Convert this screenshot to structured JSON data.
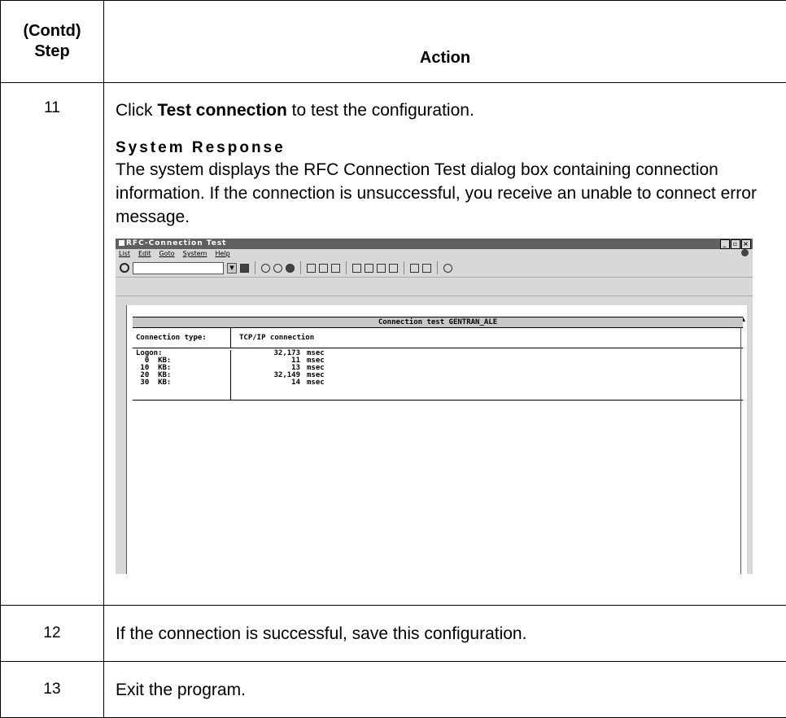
{
  "header": {
    "step_label_line1": "(Contd)",
    "step_label_line2": "Step",
    "action_label": "Action"
  },
  "rows": [
    {
      "step": "11",
      "lead_prefix": "Click ",
      "lead_bold": "Test connection",
      "lead_suffix": " to test the configuration.",
      "response_title": "System Response",
      "response_body": "The system displays the RFC Connection Test dialog box containing connection information. If the connection is unsuccessful, you receive an unable to connect error message."
    },
    {
      "step": "12",
      "text": "If the connection is successful, save this configuration."
    },
    {
      "step": "13",
      "text": "Exit the program."
    }
  ],
  "sap": {
    "window_title": "RFC-Connection Test",
    "menu": [
      "List",
      "Edit",
      "Goto",
      "System",
      "Help"
    ],
    "panel_title": "Connection test GENTRAN_ALE",
    "connection_type_label": "Connection type:",
    "connection_type_value": "TCP/IP connection",
    "timings": [
      {
        "label": "Logon:",
        "value": "32,173",
        "unit": "msec"
      },
      {
        "label": "  0  KB:",
        "value": "11",
        "unit": "msec"
      },
      {
        "label": " 10  KB:",
        "value": "13",
        "unit": "msec"
      },
      {
        "label": " 20  KB:",
        "value": "32,149",
        "unit": "msec"
      },
      {
        "label": " 30  KB:",
        "value": "14",
        "unit": "msec"
      }
    ]
  }
}
